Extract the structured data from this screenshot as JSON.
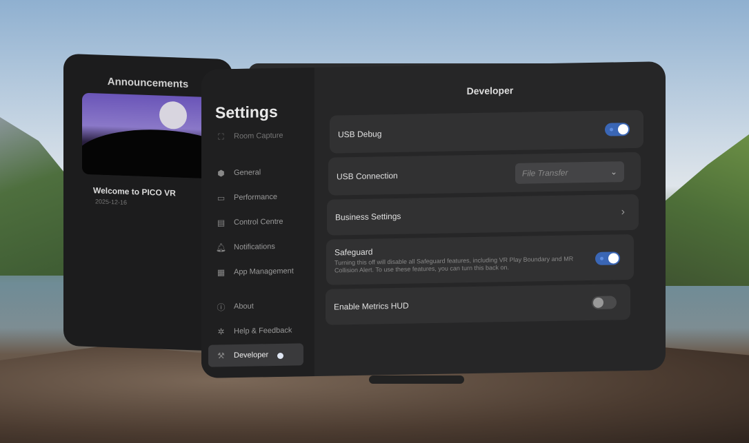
{
  "announcements": {
    "title": "Announcements",
    "item_title": "Welcome to PICO VR",
    "item_date": "2025-12-16"
  },
  "sidebar": {
    "title": "Settings",
    "items": [
      {
        "label": "Room Capture",
        "icon": "room-capture-icon"
      },
      {
        "label": "General",
        "icon": "gear-icon"
      },
      {
        "label": "Performance",
        "icon": "performance-icon"
      },
      {
        "label": "Control Centre",
        "icon": "control-centre-icon"
      },
      {
        "label": "Notifications",
        "icon": "bell-icon"
      },
      {
        "label": "App Management",
        "icon": "grid-icon"
      },
      {
        "label": "About",
        "icon": "info-icon"
      },
      {
        "label": "Help & Feedback",
        "icon": "bug-icon"
      },
      {
        "label": "Developer",
        "icon": "tools-icon"
      }
    ]
  },
  "main": {
    "title": "Developer",
    "usb_debug": {
      "label": "USB Debug",
      "on": true
    },
    "usb_connection": {
      "label": "USB Connection",
      "value": "File Transfer"
    },
    "business": {
      "label": "Business Settings"
    },
    "safeguard": {
      "label": "Safeguard",
      "description": "Turning this off will disable all Safeguard features, including VR Play Boundary and MR Collision Alert. To use these features, you can turn this back on.",
      "on": true
    },
    "metrics_hud": {
      "label": "Enable Metrics HUD",
      "on": false
    }
  },
  "colors": {
    "accent": "#3a66b5",
    "panel": "#262627",
    "card": "#313132"
  }
}
